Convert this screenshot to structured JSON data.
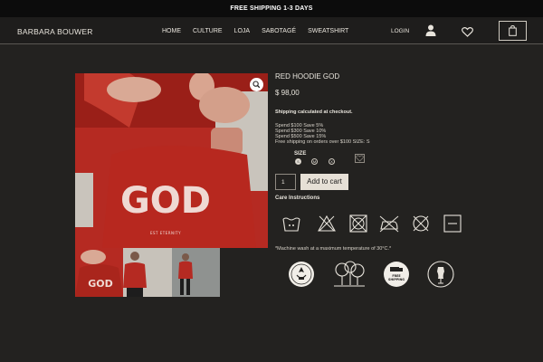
{
  "topbar": {
    "text": "FREE SHIPPING 1-3 DAYS"
  },
  "header": {
    "brand": "BARBARA BOUWER",
    "nav": [
      "HOME",
      "CULTURE",
      "LOJA",
      "SABOTAGÉ",
      "SWEATSHIRT"
    ],
    "login": "LOGIN"
  },
  "product": {
    "title": "RED HOODIE GOD",
    "price": "$ 98,00",
    "shipping_note": "Shipping calculated at checkout.",
    "promos": [
      "Spend $100 Save 5%",
      "Spend $300 Save 10%",
      "Spend $500 Save 15%",
      "Free shipping on orders over $100 SIZE:  S"
    ],
    "size_label": "SIZE",
    "sizes": [
      "S",
      "M",
      "X"
    ],
    "selected_size": "S",
    "quantity": "1",
    "add_to_cart": "Add to cart",
    "care_title": "Care Instructions",
    "care_icons": [
      "wash-30-icon",
      "no-bleach-icon",
      "no-tumble-dry-icon",
      "no-iron-icon",
      "no-dry-clean-icon",
      "dry-flat-icon"
    ],
    "care_note": "*Machine wash at a maximum temperature of 30°C.*",
    "badges": [
      "ecofriendly-badge",
      "trees-badge",
      "free-shipping-badge",
      "mannequin-badge"
    ],
    "hoodie_print": "GOD",
    "hoodie_sub": "EST ETERNITY",
    "badge_free": "FREE",
    "badge_shipping": "SHIPPING"
  },
  "colors": {
    "background": "#232220",
    "topbar": "#0c0c0c",
    "hoodie_red": "#b52a22",
    "button": "#e6e0d6"
  }
}
